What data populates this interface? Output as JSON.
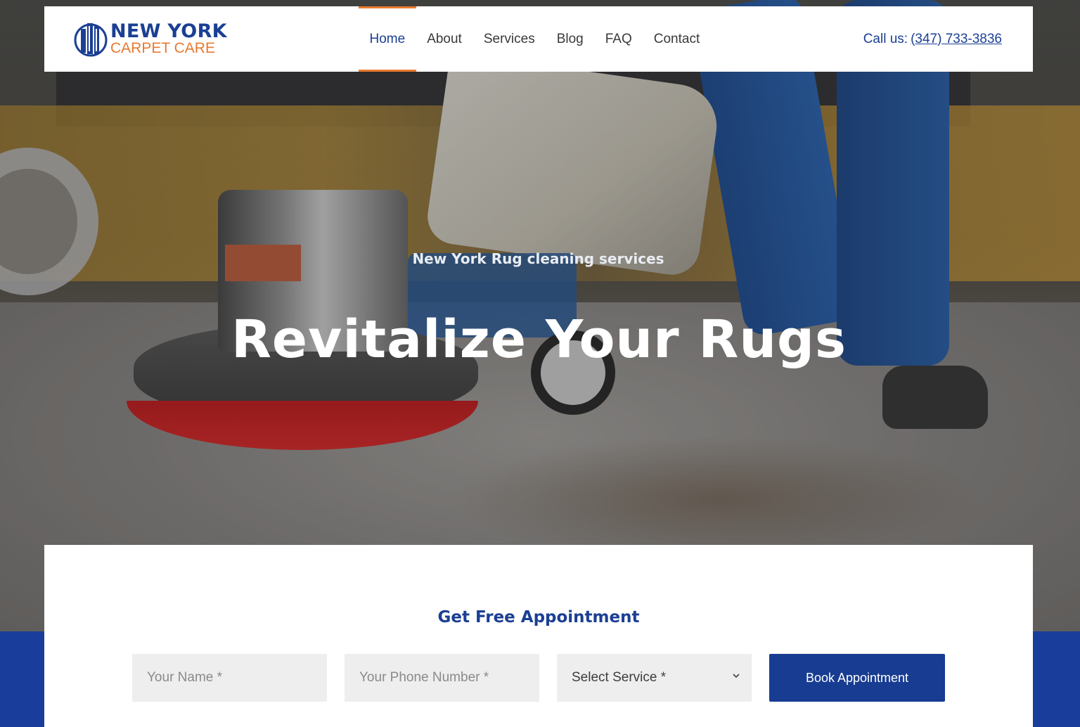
{
  "brand": {
    "line1": "NEW YORK",
    "line2": "CARPET CARE",
    "primary_color": "#1b3f93",
    "accent_color": "#e8792f"
  },
  "nav": {
    "items": [
      {
        "label": "Home",
        "active": true
      },
      {
        "label": "About",
        "active": false
      },
      {
        "label": "Services",
        "active": false
      },
      {
        "label": "Blog",
        "active": false
      },
      {
        "label": "FAQ",
        "active": false
      },
      {
        "label": "Contact",
        "active": false
      }
    ]
  },
  "contact": {
    "call_label": "Call us:",
    "phone": "(347) 733-3836"
  },
  "hero": {
    "subtitle": "New York Rug cleaning services",
    "title": "Revitalize Your Rugs"
  },
  "appointment": {
    "title": "Get Free Appointment",
    "name_placeholder": "Your Name *",
    "phone_placeholder": "Your Phone Number *",
    "service_selected": "Select Service *",
    "submit_label": "Book Appointment"
  },
  "icons": {
    "logo": "building-logo-icon",
    "select": "chevron-down-icon"
  }
}
